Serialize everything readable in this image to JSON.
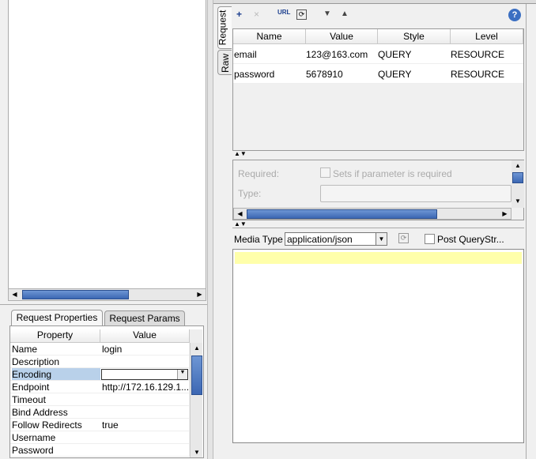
{
  "left": {
    "tabs": [
      "Request Properties",
      "Request Params"
    ],
    "props_headers": [
      "Property",
      "Value"
    ],
    "props": [
      {
        "name": "Name",
        "value": "login"
      },
      {
        "name": "Description",
        "value": ""
      },
      {
        "name": "Encoding",
        "value": ""
      },
      {
        "name": "Endpoint",
        "value": "http://172.16.129.1..."
      },
      {
        "name": "Timeout",
        "value": ""
      },
      {
        "name": "Bind Address",
        "value": ""
      },
      {
        "name": "Follow Redirects",
        "value": "true"
      },
      {
        "name": "Username",
        "value": ""
      },
      {
        "name": "Password",
        "value": ""
      }
    ]
  },
  "right": {
    "side_tabs": [
      "Request",
      "Raw"
    ],
    "params_headers": [
      "Name",
      "Value",
      "Style",
      "Level"
    ],
    "params": [
      {
        "name": "email",
        "value": "123@163.com",
        "style": "QUERY",
        "level": "RESOURCE"
      },
      {
        "name": "password",
        "value": "5678910",
        "style": "QUERY",
        "level": "RESOURCE"
      }
    ],
    "required_label": "Required:",
    "required_check_label": "Sets if parameter is required",
    "type_label": "Type:",
    "media_type_label": "Media Type",
    "media_type_value": "application/json",
    "post_query_label": "Post QueryStr...",
    "help_icon": "?"
  }
}
